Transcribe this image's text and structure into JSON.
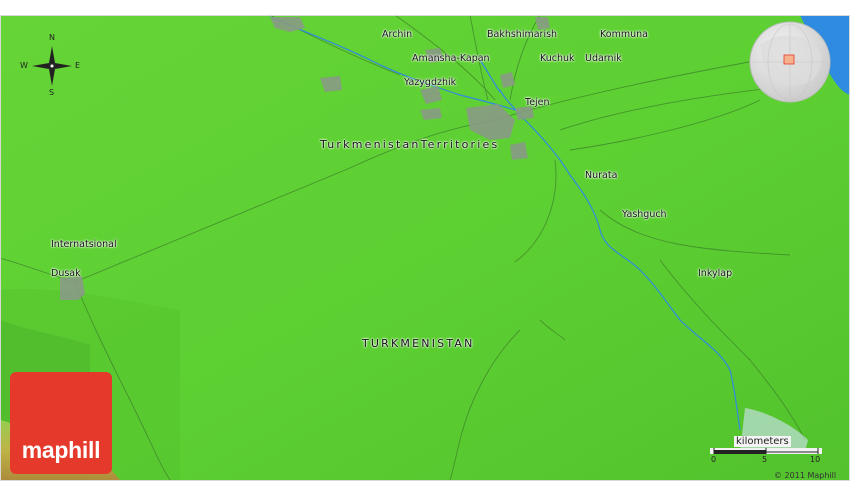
{
  "map": {
    "country_label": "TURKMENISTAN",
    "region_label": "TurkmenistanTerritories",
    "places": [
      {
        "name": "Archin",
        "lon": 61.33,
        "lat": 38.92
      },
      {
        "name": "Bakhshimarish",
        "lon": 61.47,
        "lat": 38.92
      },
      {
        "name": "Kommuna",
        "lon": 61.62,
        "lat": 38.92
      },
      {
        "name": "Amansha-Kapan",
        "lon": 61.37,
        "lat": 38.87
      },
      {
        "name": "Kuchuk",
        "lon": 61.54,
        "lat": 38.87
      },
      {
        "name": "Udarnik",
        "lon": 61.6,
        "lat": 38.87
      },
      {
        "name": "Yazygdzhik",
        "lon": 61.36,
        "lat": 38.82
      },
      {
        "name": "Tejen",
        "lon": 61.52,
        "lat": 38.78
      },
      {
        "name": "Nurata",
        "lon": 61.6,
        "lat": 38.63
      },
      {
        "name": "Yashguch",
        "lon": 61.65,
        "lat": 38.55
      },
      {
        "name": "Internatsional",
        "lon": 60.89,
        "lat": 38.49
      },
      {
        "name": "Inkylap",
        "lon": 61.75,
        "lat": 38.43
      },
      {
        "name": "Dusak",
        "lon": 60.89,
        "lat": 38.43
      }
    ]
  },
  "compass": {
    "n": "N",
    "s": "S",
    "e": "E",
    "w": "W"
  },
  "scale": {
    "label": "kilometers",
    "ticks": [
      "0",
      "5",
      "10"
    ]
  },
  "brand": {
    "logo_text": "maphill",
    "copyright": "© 2011 Maphill"
  },
  "colors": {
    "land": "#5ccf32",
    "land_dark": "#4fb32b",
    "water": "#2f8be0",
    "urban": "#8a9a86",
    "roads": "#3f8a2a",
    "brand": "#e53a2b"
  }
}
